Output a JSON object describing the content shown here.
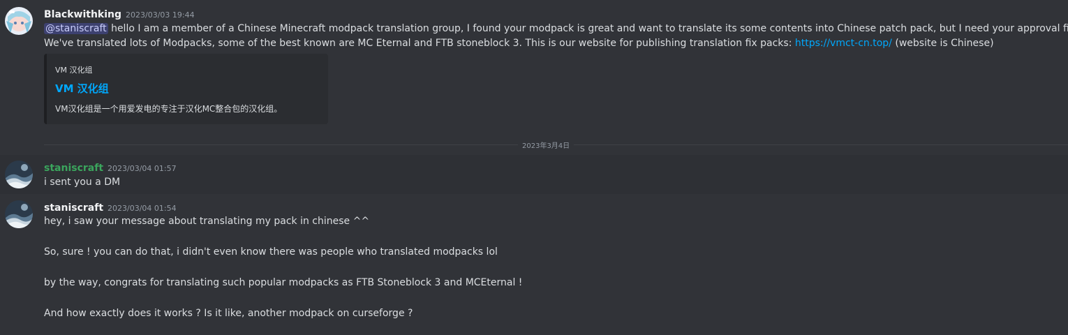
{
  "messages": [
    {
      "author": "Blackwithking",
      "timestamp": "2023/03/03 19:44",
      "mention": "@staniscraft",
      "line1_text": " hello  I am a member of a Chinese Minecraft modpack translation group, I found your modpack is great and want to translate its some contents into Chinese patch pack, but I need your approval first.",
      "line2_text": "We've translated lots of Modpacks,  some of the best known are MC Eternal and FTB stoneblock 3. This is our website for publishing translation fix packs: ",
      "link": "https://vmct-cn.top/",
      "line2_suffix": " (website is Chinese)",
      "embed": {
        "provider": "VM 汉化组",
        "title": "VM 汉化组",
        "description": "VM汉化组是一个用爱发电的专注于汉化MC整合包的汉化组。"
      }
    },
    {
      "author": "staniscraft",
      "timestamp": "2023/03/04 01:57",
      "text": "i sent you a DM"
    },
    {
      "author": "staniscraft",
      "timestamp": "2023/03/04 01:54",
      "lines": [
        "hey, i saw your message about translating my pack in chinese ^^",
        "So, sure ! you can do that, i didn't even know there was people who translated modpacks lol",
        "by the way, congrats for translating such popular modpacks as FTB Stoneblock 3 and MCEternal !",
        "And how exactly does it works ? Is it like, another modpack on curseforge ?"
      ]
    }
  ],
  "date_divider": "2023年3月4日",
  "colors": {
    "background": "#313338",
    "username_green": "#3ba55d",
    "link": "#00a8fc",
    "mention_bg": "#5865f2"
  }
}
